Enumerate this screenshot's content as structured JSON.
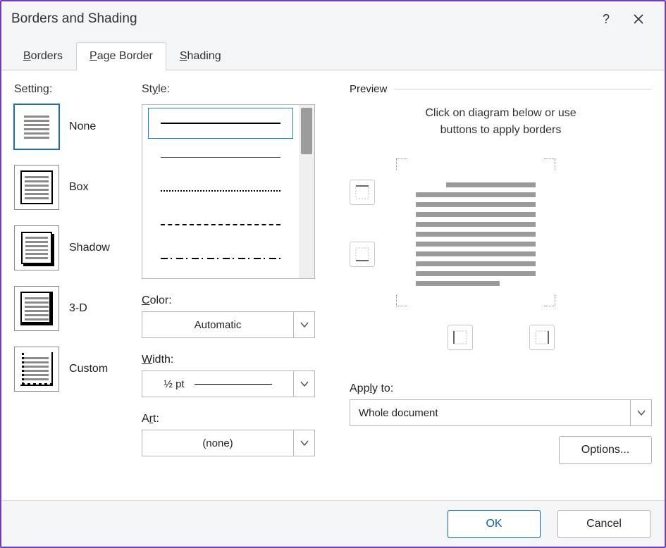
{
  "title": "Borders and Shading",
  "tabs": {
    "borders": "Borders",
    "page_border": "Page Border",
    "shading": "Shading",
    "active": "page_border"
  },
  "setting": {
    "label": "Setting:",
    "items": [
      {
        "key": "none",
        "label": "None"
      },
      {
        "key": "box",
        "label": "Box"
      },
      {
        "key": "shadow",
        "label": "Shadow"
      },
      {
        "key": "threeD",
        "label": "3-D"
      },
      {
        "key": "custom",
        "label": "Custom"
      }
    ],
    "selected": "none"
  },
  "style": {
    "label": "Style:",
    "selected_index": 0,
    "items": [
      "solid",
      "fine",
      "dot",
      "dash",
      "dashdot"
    ]
  },
  "color": {
    "label": "Color:",
    "value": "Automatic"
  },
  "width": {
    "label": "Width:",
    "value": "½ pt"
  },
  "art": {
    "label": "Art:",
    "value": "(none)"
  },
  "preview": {
    "label": "Preview",
    "hint_line1": "Click on diagram below or use",
    "hint_line2": "buttons to apply borders"
  },
  "apply_to": {
    "label": "Apply to:",
    "value": "Whole document"
  },
  "buttons": {
    "options": "Options...",
    "ok": "OK",
    "cancel": "Cancel"
  }
}
